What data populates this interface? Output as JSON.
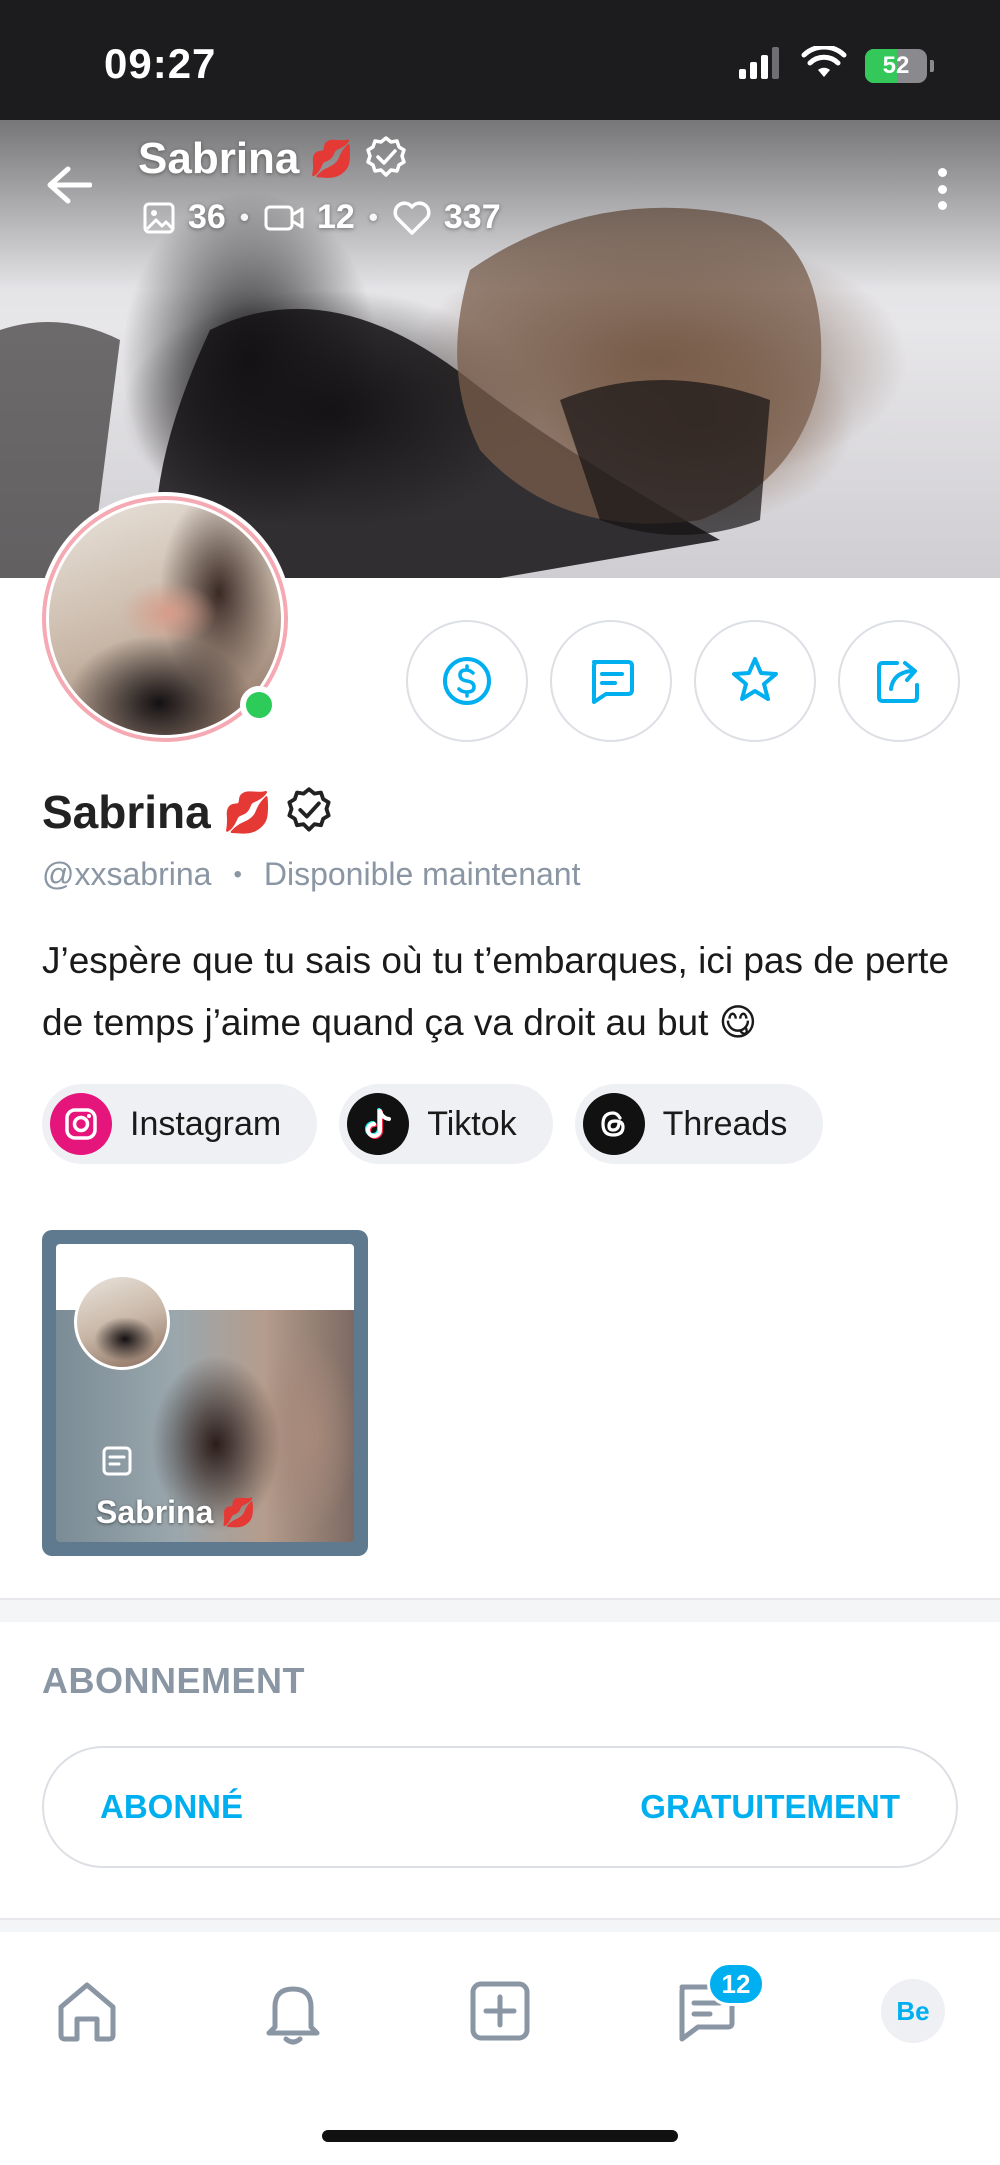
{
  "status_bar": {
    "time": "09:27",
    "battery_level": "52",
    "icons": [
      "signal-icon",
      "wifi-icon",
      "battery-icon"
    ]
  },
  "header": {
    "name": "Sabrina",
    "name_emoji": "💋",
    "stats": {
      "photos": "36",
      "videos": "12",
      "likes": "337"
    },
    "separator": "•"
  },
  "profile": {
    "name": "Sabrina",
    "name_emoji": "💋",
    "handle": "@xxsabrina",
    "separator": "•",
    "availability": "Disponible maintenant",
    "bio": "J’espère que tu sais où tu t’embarques, ici pas de perte de temps j’aime quand ça va droit au but 😋",
    "online": true
  },
  "socials": [
    {
      "label": "Instagram",
      "icon": "instagram-icon"
    },
    {
      "label": "Tiktok",
      "icon": "tiktok-icon"
    },
    {
      "label": "Threads",
      "icon": "threads-icon"
    }
  ],
  "post": {
    "title": "Sabrina",
    "title_emoji": "💋"
  },
  "subscription": {
    "section_title": "ABONNEMENT",
    "status_label": "ABONNÉ",
    "price_label": "GRATUITEMENT"
  },
  "bottom_nav": {
    "messages_badge": "12",
    "profile_initials": "Be"
  },
  "colors": {
    "accent": "#00aff0",
    "online": "#2dcb5a",
    "avatar_ring": "#f5a9b2",
    "instagram": "#e6157b",
    "muted_text": "#8a96a3"
  }
}
